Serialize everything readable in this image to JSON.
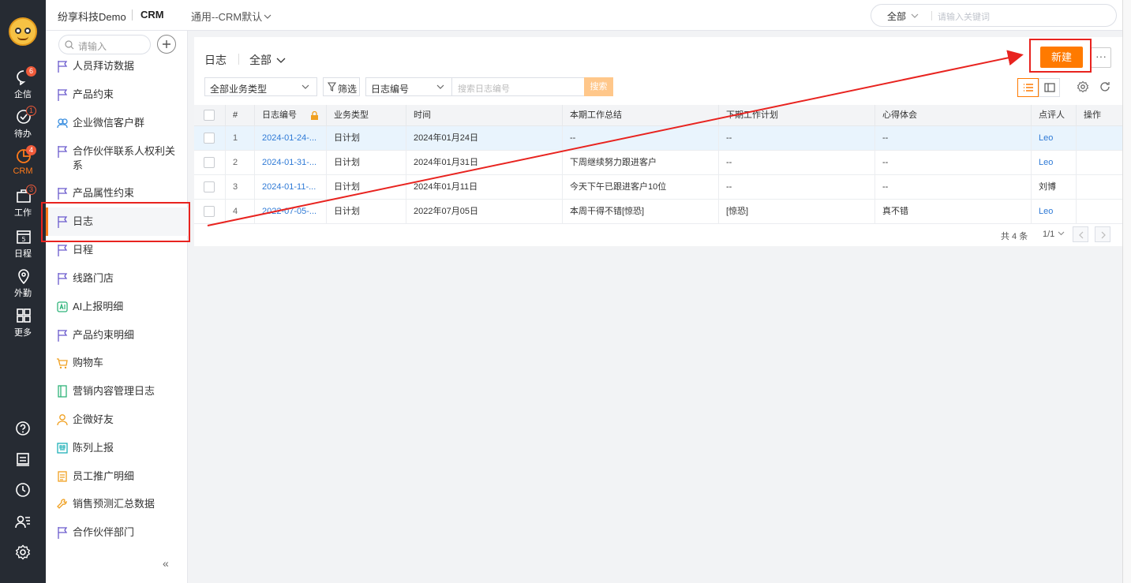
{
  "rail": {
    "items": [
      {
        "label": "企信",
        "badge": "6"
      },
      {
        "label": "待办",
        "badge": "1"
      },
      {
        "label": "CRM",
        "badge": "4"
      },
      {
        "label": "工作",
        "badge": "3"
      },
      {
        "label": "日程",
        "day": "5"
      },
      {
        "label": "外勤"
      },
      {
        "label": "更多"
      }
    ]
  },
  "topbar": {
    "company": "纷享科技Demo",
    "app": "CRM",
    "scope": "通用--CRM默认",
    "search_scope": "全部",
    "search_placeholder": "请输入关键词"
  },
  "sidebar": {
    "search_placeholder": "请输入",
    "items": [
      {
        "label": "人员拜访数据",
        "icon": "flag-icon"
      },
      {
        "label": "产品约束",
        "icon": "flag-icon"
      },
      {
        "label": "企业微信客户群",
        "icon": "group-icon"
      },
      {
        "label": "合作伙伴联系人权利关系",
        "icon": "flag-icon"
      },
      {
        "label": "产品属性约束",
        "icon": "flag-icon"
      },
      {
        "label": "日志",
        "icon": "flag-icon"
      },
      {
        "label": "日程",
        "icon": "flag-icon"
      },
      {
        "label": "线路门店",
        "icon": "flag-icon"
      },
      {
        "label": "AI上报明细",
        "icon": "ai-icon"
      },
      {
        "label": "产品约束明细",
        "icon": "flag-icon"
      },
      {
        "label": "购物车",
        "icon": "cart-icon"
      },
      {
        "label": "营销内容管理日志",
        "icon": "book-icon"
      },
      {
        "label": "企微好友",
        "icon": "person-icon"
      },
      {
        "label": "陈列上报",
        "icon": "display-icon"
      },
      {
        "label": "员工推广明细",
        "icon": "doc-icon"
      },
      {
        "label": "销售预测汇总数据",
        "icon": "wrench-icon"
      },
      {
        "label": "合作伙伴部门",
        "icon": "flag-icon"
      }
    ]
  },
  "main": {
    "title": "日志",
    "view": "全部",
    "new_label": "新建",
    "more_label": "···",
    "type_filter": "全部业务类型",
    "filter_label": "筛选",
    "search_field": "日志编号",
    "search_placeholder": "搜索日志编号",
    "search_button": "搜索"
  },
  "table": {
    "columns": [
      "#",
      "日志编号",
      "业务类型",
      "时间",
      "本期工作总结",
      "下期工作计划",
      "心得体会",
      "点评人",
      "操作"
    ],
    "rows": [
      {
        "idx": "1",
        "code": "2024-01-24-...",
        "type": "日计划",
        "time": "2024年01月24日",
        "summary": "--",
        "plan": "--",
        "insight": "--",
        "reviewer": "Leo"
      },
      {
        "idx": "2",
        "code": "2024-01-31-...",
        "type": "日计划",
        "time": "2024年01月31日",
        "summary": "下周继续努力跟进客户",
        "plan": "--",
        "insight": "--",
        "reviewer": "Leo"
      },
      {
        "idx": "3",
        "code": "2024-01-11-...",
        "type": "日计划",
        "time": "2024年01月11日",
        "summary": "今天下午已跟进客户10位",
        "plan": "--",
        "insight": "--",
        "reviewer": "刘博"
      },
      {
        "idx": "4",
        "code": "2022-07-05-...",
        "type": "日计划",
        "time": "2022年07月05日",
        "summary": "本周干得不错[惊恐]",
        "plan": "[惊恐]",
        "insight": "真不错",
        "reviewer": "Leo"
      }
    ],
    "total": "共 4 条",
    "page": "1/1"
  },
  "colors": {
    "accent": "#ff7a00",
    "rail_bg": "#262b33",
    "link": "#2f7ad6",
    "annotation": "#e8231f"
  }
}
